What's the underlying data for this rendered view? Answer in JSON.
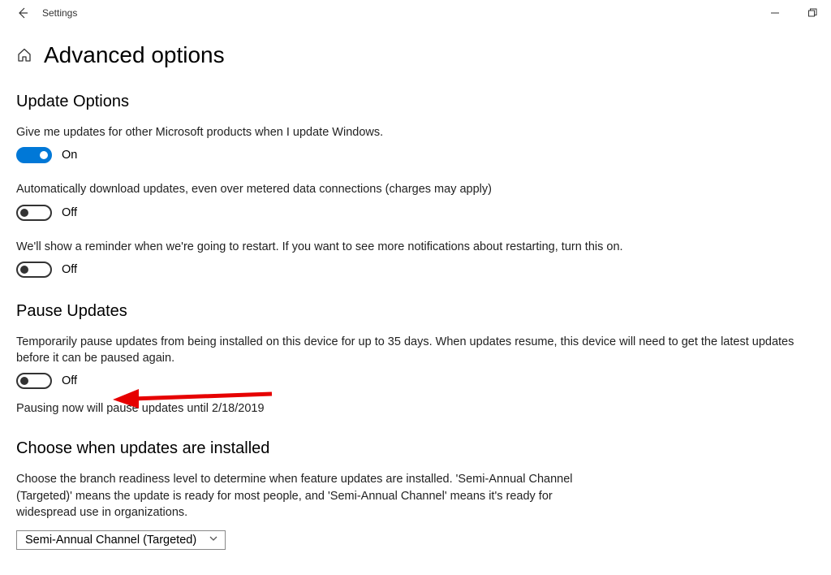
{
  "titlebar": {
    "title": "Settings"
  },
  "header": {
    "title": "Advanced options"
  },
  "updateOptions": {
    "heading": "Update Options",
    "opt1_text": "Give me updates for other Microsoft products when I update Windows.",
    "opt1_state": "On",
    "opt2_text": "Automatically download updates, even over metered data connections (charges may apply)",
    "opt2_state": "Off",
    "opt3_text": "We'll show a reminder when we're going to restart. If you want to see more notifications about restarting, turn this on.",
    "opt3_state": "Off"
  },
  "pauseUpdates": {
    "heading": "Pause Updates",
    "description": "Temporarily pause updates from being installed on this device for up to 35 days. When updates resume, this device will need to get the latest updates before it can be paused again.",
    "state": "Off",
    "note": "Pausing now will pause updates until 2/18/2019"
  },
  "chooseWhen": {
    "heading": "Choose when updates are installed",
    "description": "Choose the branch readiness level to determine when feature updates are installed. 'Semi-Annual Channel (Targeted)' means the update is ready for most people, and 'Semi-Annual Channel' means it's ready for widespread use in organizations.",
    "selected": "Semi-Annual Channel (Targeted)"
  }
}
